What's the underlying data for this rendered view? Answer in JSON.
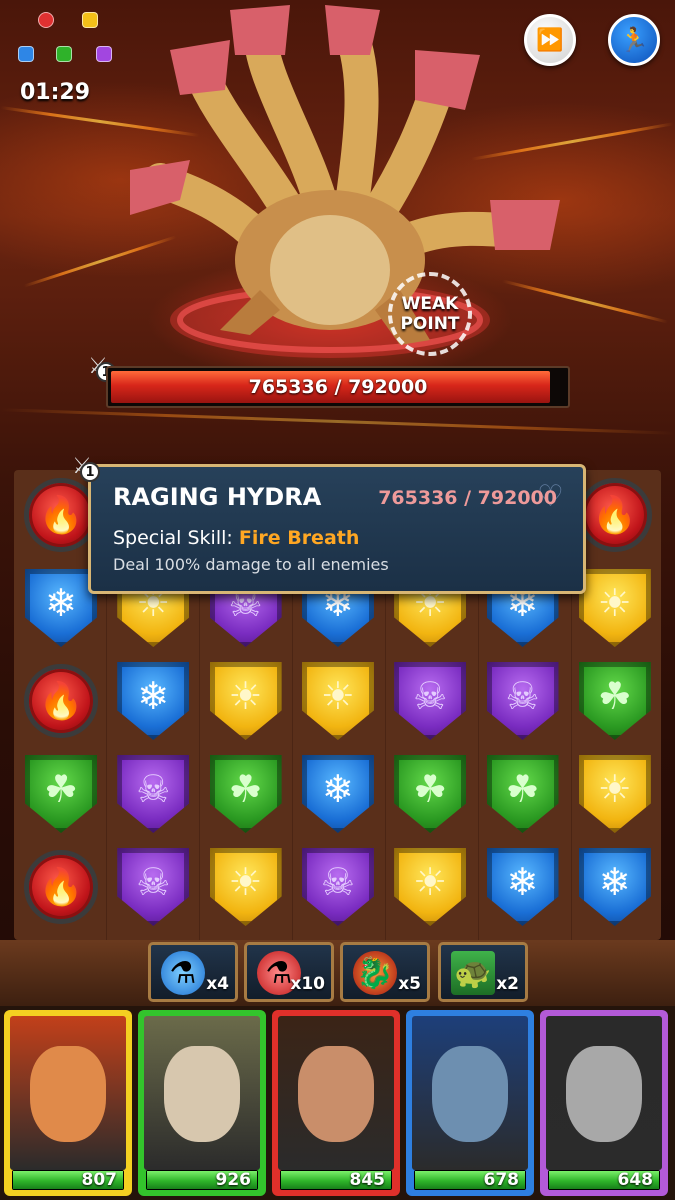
{
  "hud": {
    "timer": "01:29",
    "icons": [
      "fire-icon",
      "shield-up-icon",
      "ice-shield-icon",
      "leaf-shield-icon",
      "skull-shield-icon"
    ],
    "fast_forward_icon": "fast-forward-icon",
    "flee_icon": "running-man-icon"
  },
  "boss": {
    "name": "RAGING HYDRA",
    "level": "1",
    "hp_text": "765336 / 792000",
    "hp_fraction": 0.966,
    "weak_point_line1": "WEAK",
    "weak_point_line2": "POINT",
    "special_skill_label": "Special Skill: ",
    "special_skill_name": "Fire Breath",
    "skill_description": "Deal 100% damage to all enemies"
  },
  "board": {
    "rows": [
      [
        "fire",
        "hidden",
        "hidden",
        "hidden",
        "hidden",
        "hidden",
        "fire"
      ],
      [
        "ice",
        "sun",
        "skull",
        "ice",
        "sun",
        "ice",
        "sun"
      ],
      [
        "fire",
        "ice",
        "sun",
        "sun",
        "skull",
        "skull",
        "leaf"
      ],
      [
        "leaf",
        "skull",
        "leaf",
        "ice",
        "leaf",
        "leaf",
        "sun"
      ],
      [
        "fire",
        "skull",
        "sun",
        "skull",
        "sun",
        "ice",
        "ice"
      ]
    ],
    "colors": {
      "fire": "#d01f1f",
      "ice": "#1e74de",
      "sun": "#f3b817",
      "skull": "#8a33cc",
      "leaf": "#2da325"
    }
  },
  "items": [
    {
      "name": "mana-potion",
      "icon": "blue-flask-icon",
      "count": "x4"
    },
    {
      "name": "health-potion",
      "icon": "red-flask-icon",
      "count": "x10"
    },
    {
      "name": "dragon-bomb",
      "icon": "dragon-icon",
      "count": "x5"
    },
    {
      "name": "turtle-banner",
      "icon": "turtle-banner-icon",
      "count": "x2"
    }
  ],
  "heroes": [
    {
      "name": "hero-1",
      "frame": "#f4d021",
      "hp": "807",
      "hp_fraction": 1.0
    },
    {
      "name": "hero-2",
      "frame": "#33c42c",
      "hp": "926",
      "hp_fraction": 1.0
    },
    {
      "name": "hero-3",
      "frame": "#e0302a",
      "hp": "845",
      "hp_fraction": 1.0
    },
    {
      "name": "hero-4",
      "frame": "#2e7fe0",
      "hp": "678",
      "hp_fraction": 1.0
    },
    {
      "name": "hero-5",
      "frame": "#b35ad8",
      "hp": "648",
      "hp_fraction": 1.0
    }
  ]
}
